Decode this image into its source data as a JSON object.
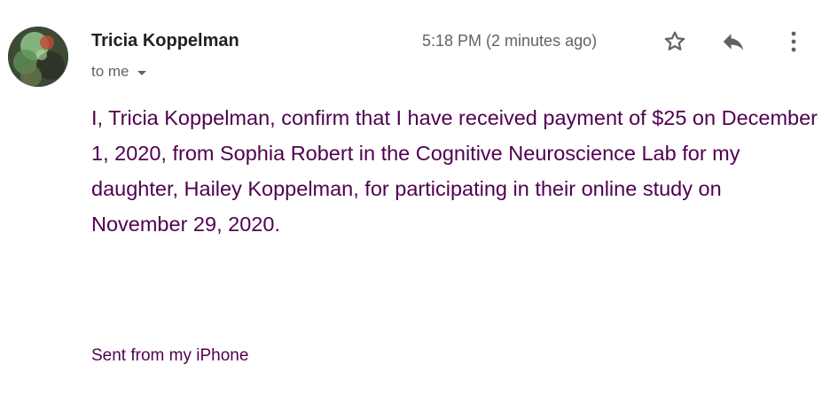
{
  "email": {
    "sender_name": "Tricia Koppelman",
    "recipient_label": "to me",
    "timestamp": "5:18 PM (2 minutes ago)",
    "body": "I, Tricia Koppelman, confirm that I have received payment of $25 on December 1, 2020, from Sophia Robert in the Cognitive Neuroscience Lab for my daughter, Hailey Koppelman, for participating in their online study on November 29, 2020.",
    "signature": "Sent from my iPhone"
  },
  "icons": {
    "avatar": "avatar-photo",
    "recipients_toggle": "chevron-down-icon",
    "star": "star-icon",
    "reply": "reply-icon",
    "more": "more-vert-icon"
  },
  "colors": {
    "body_text": "#500050",
    "sender_text": "#202124",
    "meta_text": "#5f6368"
  }
}
